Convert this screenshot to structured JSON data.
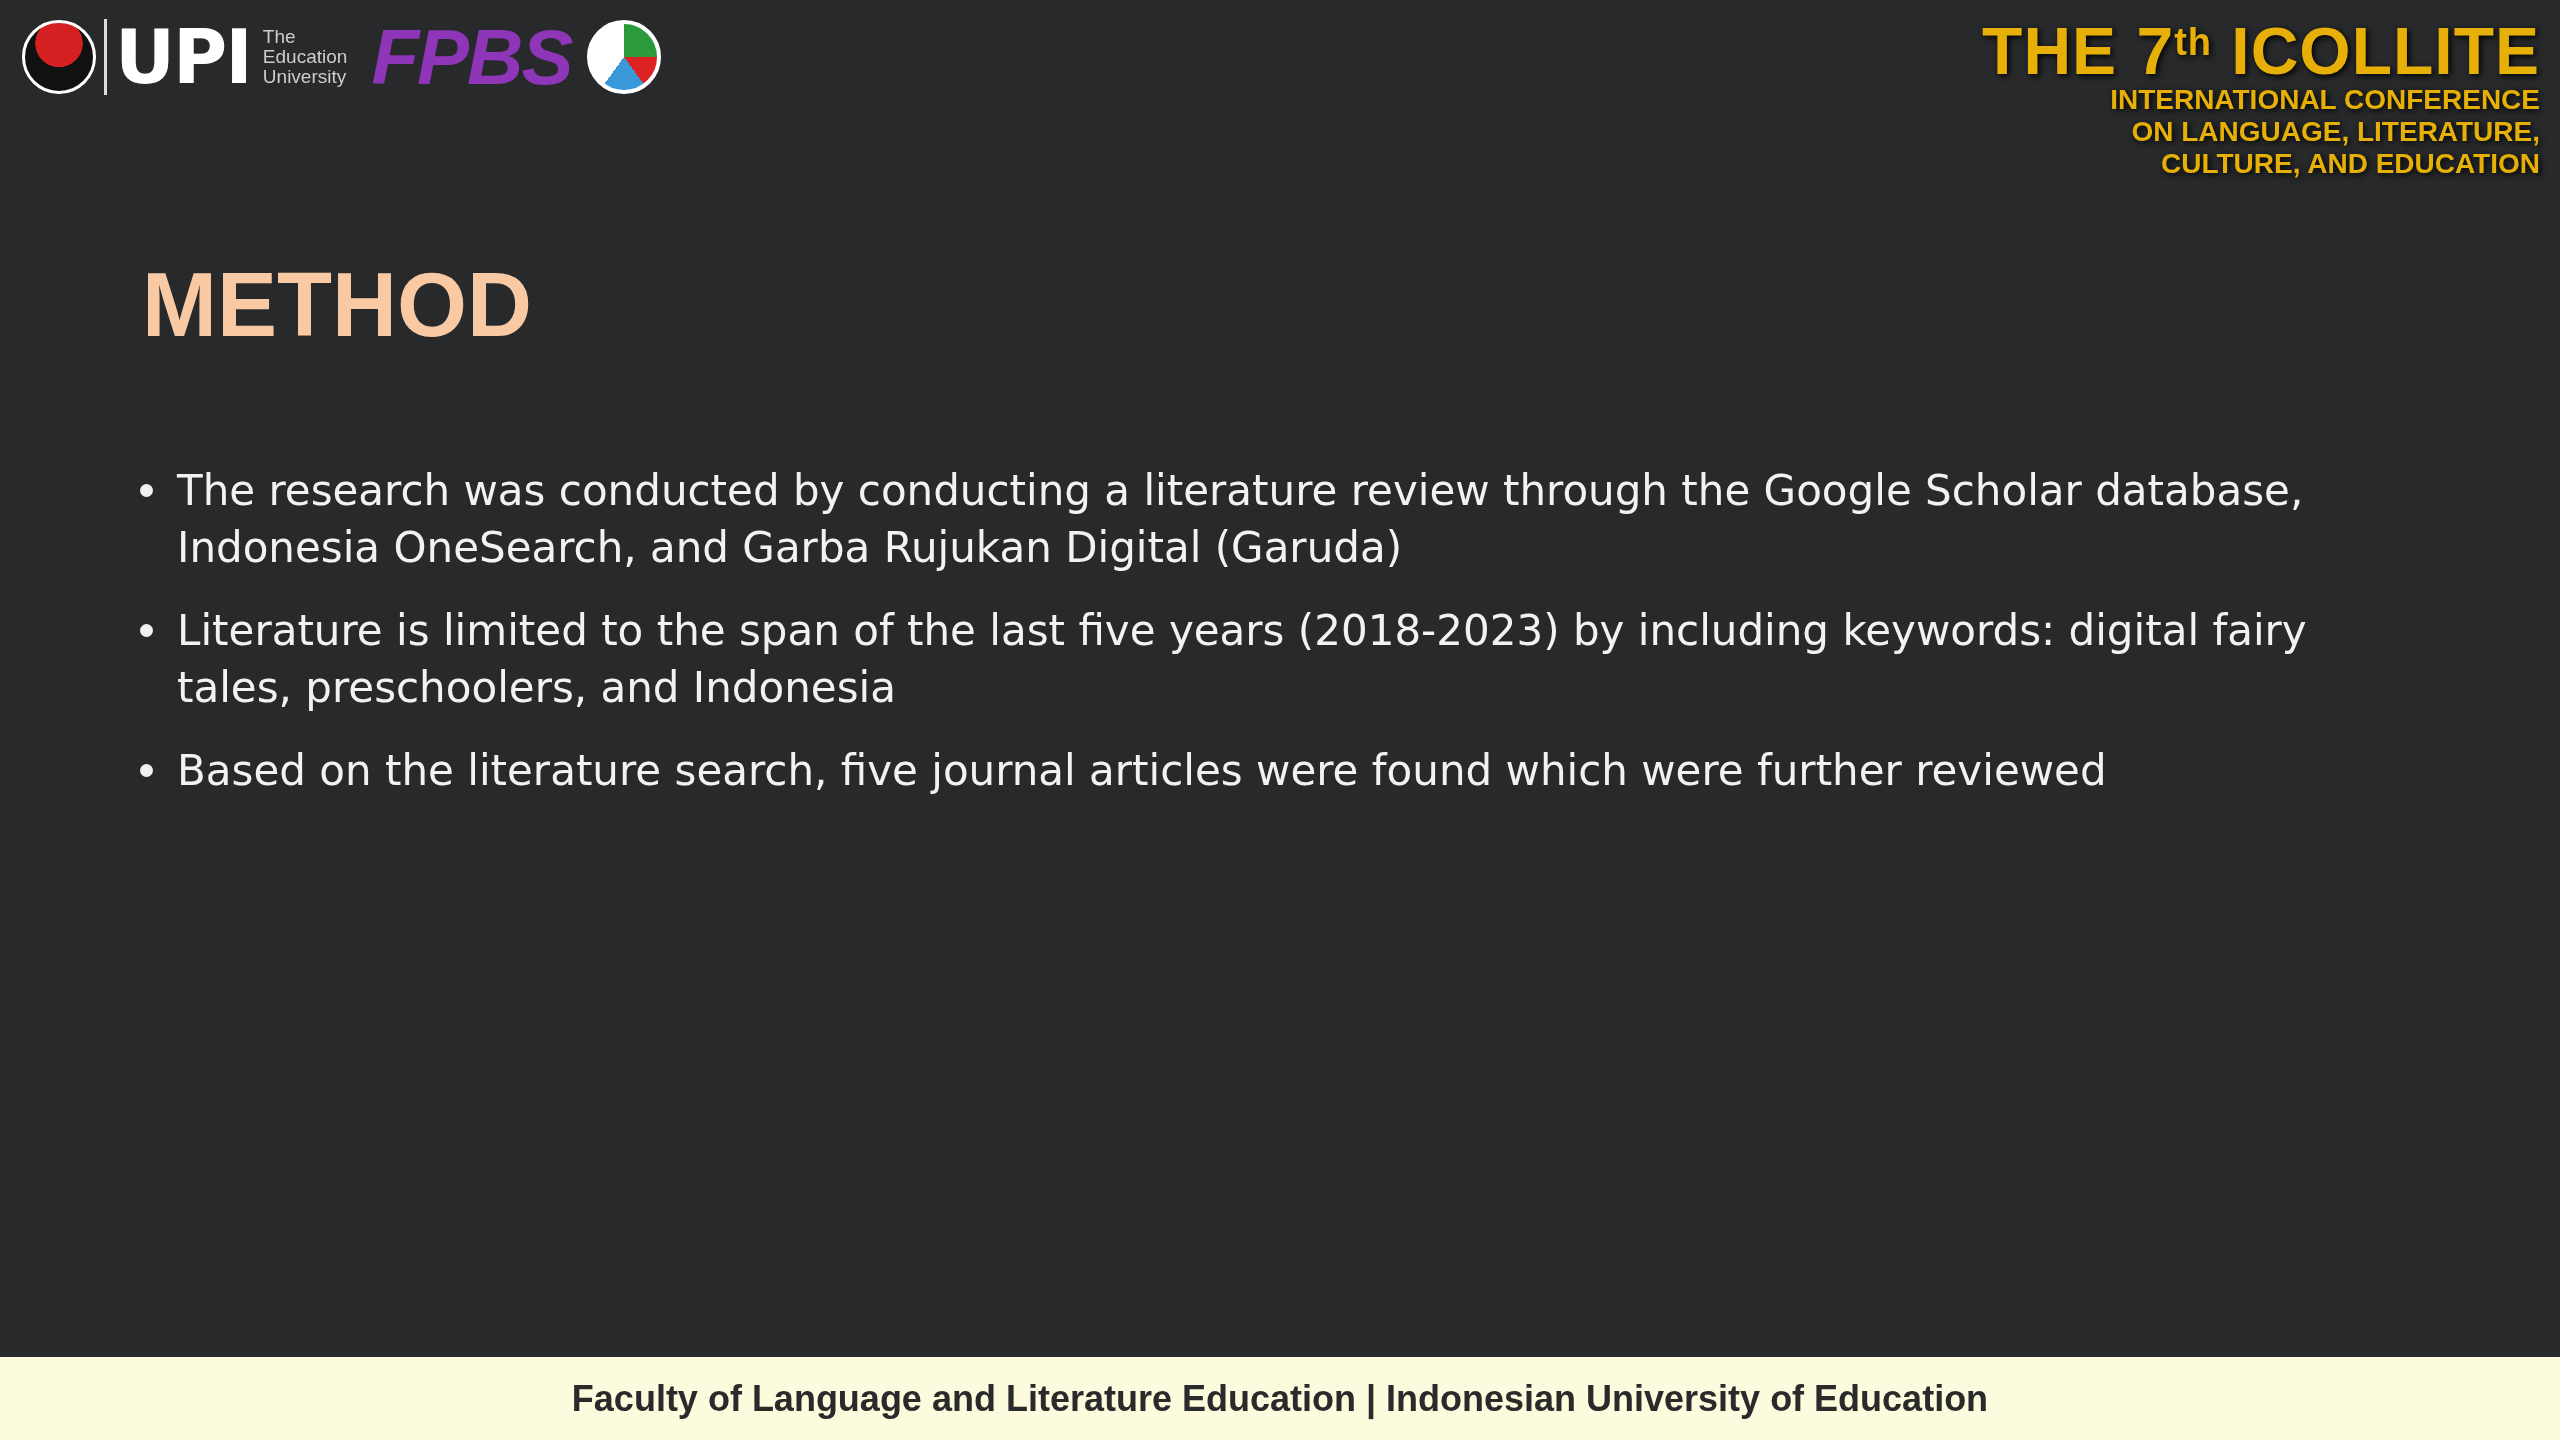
{
  "header": {
    "logos": {
      "university_mark": "UPI",
      "university_caption": [
        "The",
        "Education",
        "University"
      ],
      "faculty_mark": "FPBS"
    },
    "conference": {
      "title": "THE 7$^{th}$ ICOLLITE",
      "subtitle_lines": [
        "INTERNATIONAL CONFERENCE",
        "ON LANGUAGE, LITERATURE,",
        "CULTURE, AND EDUCATION"
      ]
    }
  },
  "slide": {
    "title": "METHOD",
    "bullets": [
      "The research was conducted by conducting a literature review through the Google Scholar database, Indonesia OneSearch, and Garba Rujukan Digital (Garuda)",
      "Literature is limited to the span of the last five years (2018-2023) by including keywords: digital fairy tales, preschoolers, and Indonesia",
      "Based on the literature search, five journal articles were found which were further reviewed"
    ]
  },
  "footer": {
    "text": "Faculty of Language and Literature Education | Indonesian University of Education"
  }
}
